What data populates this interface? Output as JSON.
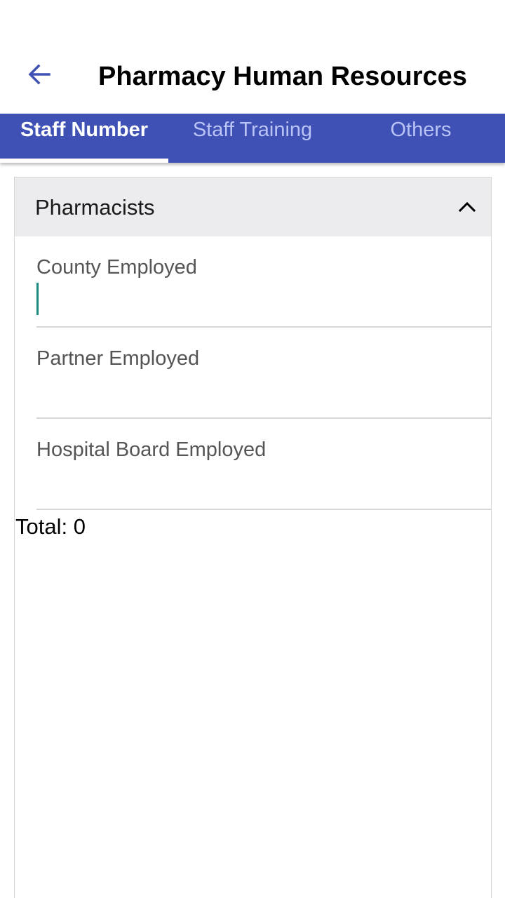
{
  "app_bar": {
    "title": "Pharmacy Human Resources",
    "back_icon": "arrow-back-icon"
  },
  "tabs": [
    {
      "label": "Staff Number",
      "active": true
    },
    {
      "label": "Staff Training",
      "active": false
    },
    {
      "label": "Others",
      "active": false
    }
  ],
  "section": {
    "title": "Pharmacists",
    "expanded": true,
    "toggle_icon": "chevron-up-icon",
    "fields": [
      {
        "label": "County Employed",
        "value": "",
        "focused": true
      },
      {
        "label": "Partner Employed",
        "value": ""
      },
      {
        "label": "Hospital Board Employed",
        "value": ""
      }
    ],
    "total_text": "Total: 0"
  },
  "colors": {
    "primary": "#3f51b5",
    "tab_inactive_text": "#b9c3f5",
    "header_background": "#ecebee",
    "focus_accent": "#1a8a80"
  }
}
